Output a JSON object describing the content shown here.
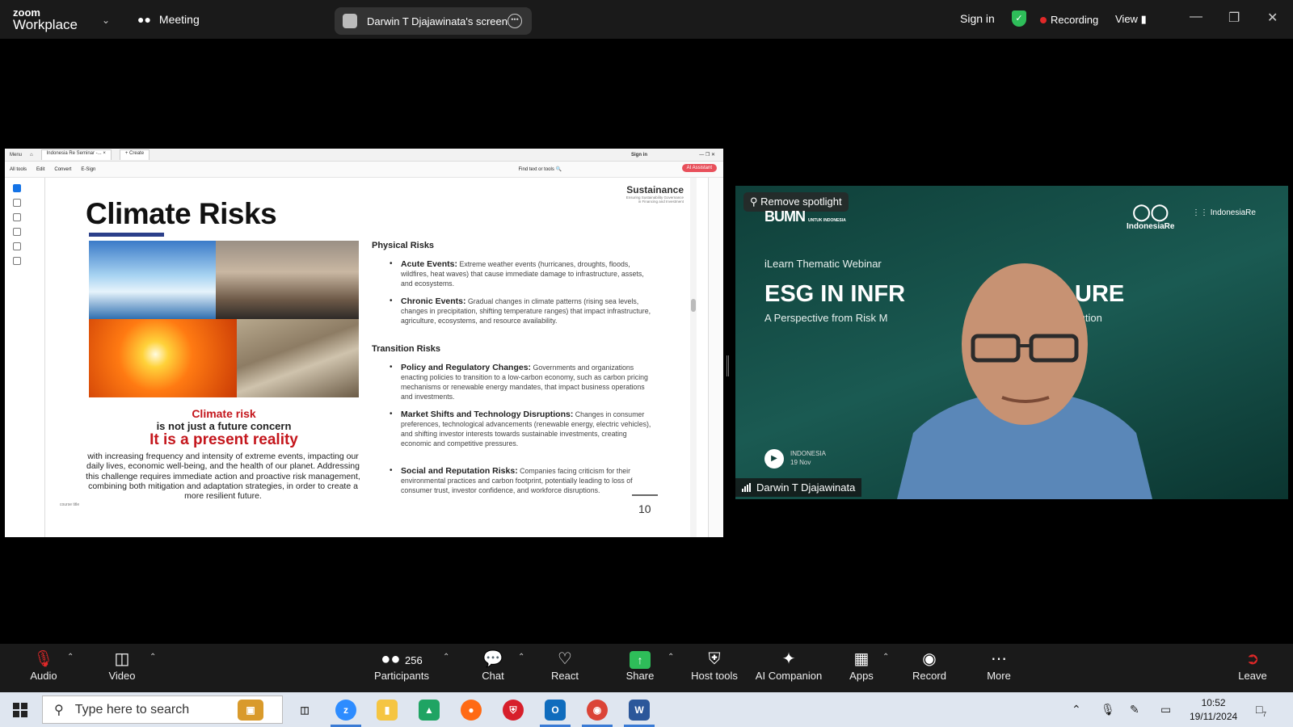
{
  "topbar": {
    "logo_small": "zoom",
    "logo_main": "Workplace",
    "meeting_label": "Meeting",
    "screen_label": "Darwin T Djajawinata's screen",
    "sign_in": "Sign in",
    "recording": "Recording",
    "view": "View"
  },
  "shared": {
    "acrobat": {
      "menu": "Menu",
      "tab": "Indonesia Re Seminar -...",
      "create": "Create",
      "sign_in": "Sign in",
      "tools": [
        "All tools",
        "Edit",
        "Convert",
        "E-Sign"
      ],
      "find": "Find text or tools",
      "ai_button": "AI Assistant"
    },
    "slide": {
      "title": "Climate Risks",
      "brand": "Sustainance",
      "brand_sub1": "Ensuring Sustainability Governance",
      "brand_sub2": "in Financing and Investment",
      "caption1": "Climate risk",
      "caption2": "is not  just a future concern",
      "caption3": "It is a present reality",
      "caption4": "with increasing frequency and intensity of extreme events, impacting our daily lives, economic well-being, and the health of our planet.  Addressing this challenge requires immediate action and proactive risk management, combining both mitigation and adaptation strategies, in order to create a more resilient future.",
      "course_title": "course title",
      "physical_heading": "Physical Risks",
      "transition_heading": "Transition Risks",
      "physical": [
        {
          "term": "Acute Events:",
          "text": " Extreme weather events (hurricanes, droughts, floods, wildfires, heat waves) that cause immediate damage to infrastructure, assets, and ecosystems."
        },
        {
          "term": "Chronic Events:",
          "text": " Gradual changes in climate patterns (rising sea levels, changes in precipitation, shifting temperature ranges) that impact infrastructure, agriculture, ecosystems, and resource availability."
        }
      ],
      "transition": [
        {
          "term": "Policy and Regulatory Changes:",
          "text": " Governments and organizations enacting policies to transition to a low-carbon economy, such as carbon pricing mechanisms or renewable energy mandates, that impact business operations and investments."
        },
        {
          "term": "Market Shifts and Technology Disruptions:",
          "text": " Changes in consumer preferences, technological advancements (renewable energy, electric vehicles), and shifting investor interests towards sustainable investments, creating economic and competitive pressures."
        },
        {
          "term": "Social and Reputation Risks:",
          "text": " Companies facing criticism for their environmental practices and carbon footprint, potentially leading to loss of consumer trust, investor confidence, and workforce disruptions."
        }
      ],
      "page_number": "10"
    }
  },
  "video": {
    "remove_spotlight": "Remove spotlight",
    "bumn": "BUMN",
    "bumn_sub": "UNTUK INDONESIA",
    "indonesia_re": "IndonesiaRe",
    "indonesia_re_institute": "IndonesiaRe",
    "ilearn": "iLearn Thematic Webinar",
    "esg_title": "ESG IN INFR",
    "esg_title_end": "URE",
    "esg_sub": "A Perspective from Risk M",
    "esg_sub_end": "e Solution",
    "corner_line1": "INDONESIA",
    "corner_line2": "19 Nov",
    "name": "Darwin T Djajawinata"
  },
  "toolbar": {
    "audio": "Audio",
    "video": "Video",
    "participants": "Participants",
    "participant_count": "256",
    "chat": "Chat",
    "react": "React",
    "share": "Share",
    "host_tools": "Host tools",
    "ai_companion": "AI Companion",
    "apps": "Apps",
    "record": "Record",
    "more": "More",
    "leave": "Leave"
  },
  "taskbar": {
    "search_placeholder": "Type here to search",
    "time": "10:52",
    "date": "19/11/2024",
    "notifications": "7"
  }
}
